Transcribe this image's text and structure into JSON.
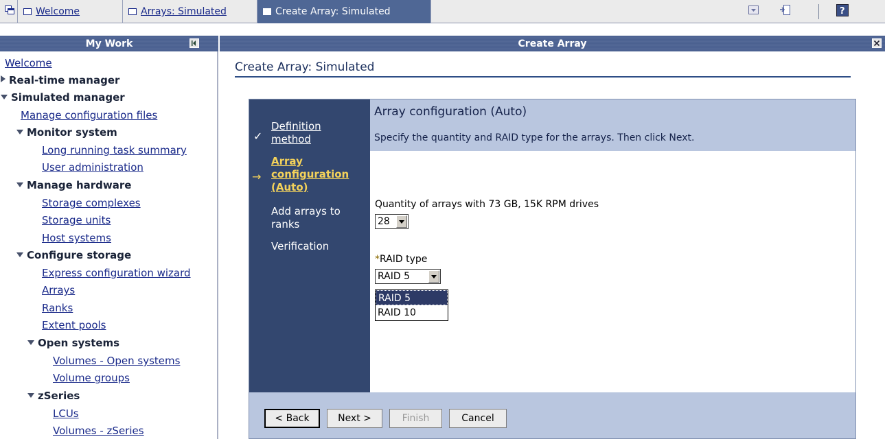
{
  "tabs": [
    {
      "label": "Welcome",
      "active": false
    },
    {
      "label": "Arrays: Simulated",
      "active": false
    },
    {
      "label": "Create Array: Simulated",
      "active": true
    }
  ],
  "nav": {
    "title": "My Work",
    "items": [
      {
        "label": "Welcome",
        "type": "link"
      },
      {
        "label": "Real-time manager",
        "type": "collapsed"
      },
      {
        "label": "Simulated manager",
        "type": "expanded"
      },
      {
        "label": "Manage configuration files",
        "type": "link"
      },
      {
        "label": "Monitor system",
        "type": "expanded"
      },
      {
        "label": "Long running task summary",
        "type": "link"
      },
      {
        "label": "User administration",
        "type": "link"
      },
      {
        "label": "Manage hardware",
        "type": "expanded"
      },
      {
        "label": "Storage complexes",
        "type": "link"
      },
      {
        "label": "Storage units",
        "type": "link"
      },
      {
        "label": "Host systems",
        "type": "link"
      },
      {
        "label": "Configure storage",
        "type": "expanded"
      },
      {
        "label": "Express configuration wizard",
        "type": "link"
      },
      {
        "label": "Arrays",
        "type": "link"
      },
      {
        "label": "Ranks",
        "type": "link"
      },
      {
        "label": "Extent pools",
        "type": "link"
      },
      {
        "label": "Open systems",
        "type": "expanded"
      },
      {
        "label": "Volumes - Open systems",
        "type": "link"
      },
      {
        "label": "Volume groups",
        "type": "link"
      },
      {
        "label": "zSeries",
        "type": "expanded"
      },
      {
        "label": "LCUs",
        "type": "link"
      },
      {
        "label": "Volumes - zSeries",
        "type": "link"
      }
    ]
  },
  "panel": {
    "title": "Create Array"
  },
  "page_title": "Create Array: Simulated",
  "wizard": {
    "steps": [
      {
        "lines": [
          "Definition",
          "method"
        ],
        "state": "done"
      },
      {
        "lines": [
          "Array",
          "configuration",
          "(Auto)"
        ],
        "state": "current"
      },
      {
        "lines": [
          "Add arrays to",
          "ranks"
        ],
        "state": "pending"
      },
      {
        "lines": [
          "Verification"
        ],
        "state": "pending"
      }
    ],
    "header_title": "Array configuration (Auto)",
    "header_desc": "Specify the quantity and RAID type for the arrays. Then click Next.",
    "quantity_label": "Quantity of arrays with 73 GB, 15K RPM drives",
    "quantity_value": "28",
    "raid_required_mark": "*",
    "raid_label": "RAID type",
    "raid_value": "RAID 5",
    "raid_options": [
      "RAID 5",
      "RAID 10"
    ],
    "buttons": {
      "back": "< Back",
      "next": "Next >",
      "finish": "Finish",
      "cancel": "Cancel"
    }
  },
  "colors": {
    "accent": "#4a6090",
    "step_current": "#f4d25a",
    "nav_bg": "#33476f",
    "header_bg": "#b9c6df"
  }
}
